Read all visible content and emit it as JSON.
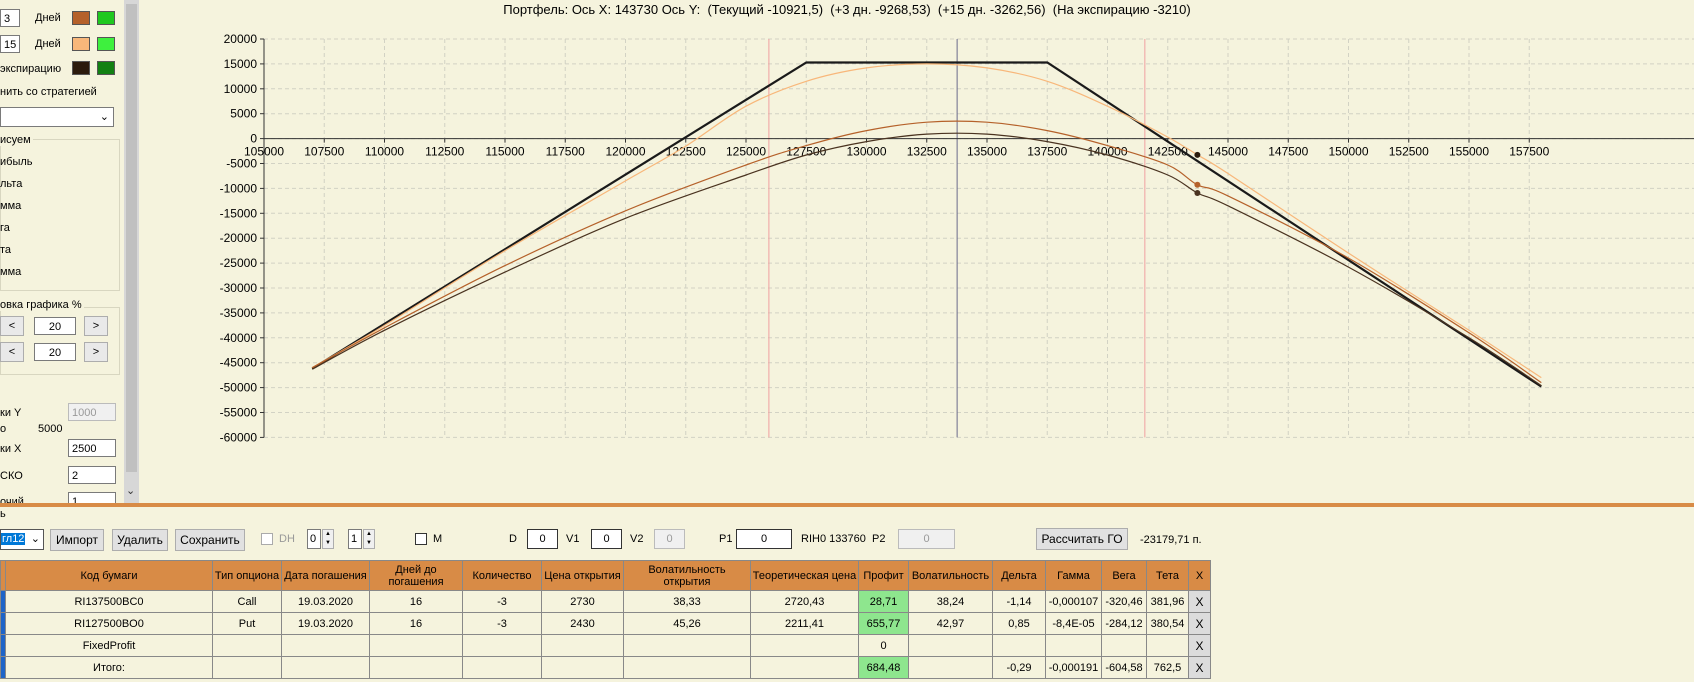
{
  "left_panel": {
    "day_rows": [
      {
        "value": "3",
        "label": "Дней",
        "color1": "#B5612A",
        "color2": "#1FC81F"
      },
      {
        "value": "15",
        "label": "Дней",
        "color1": "#F8B77A",
        "color2": "#3EF03E"
      }
    ],
    "expiry_label": "экспирацию",
    "expiry_colors": [
      "#2B1A0C",
      "#128012"
    ],
    "compare_label": "нить со стратегией",
    "draw_group_label": "исуем",
    "draw_items": [
      "ибыль",
      "льта",
      "мма",
      "га",
      "та",
      "мма"
    ],
    "chart_setting_label": "овка графика %",
    "scale1": "20",
    "scale2": "20",
    "prev_label": "<",
    "next_label": ">",
    "y_step_label": "ки Y",
    "y_step_value": "1000",
    "o_label": "о",
    "o_value": "5000",
    "x_step_label": "ки X",
    "x_step_value": "2500",
    "sko_label": "СКО",
    "sko_value": "2",
    "last_label": "очий",
    "last_value": "1"
  },
  "chart": {
    "title": "Портфель: Ось X: 143730 Ось Y:  (Текущий -10921,5)  (+3 дн. -9268,53)  (+15 дн. -3262,56)  (На экспирацию -3210)"
  },
  "chart_data": {
    "type": "line",
    "xlim": [
      105000,
      157500
    ],
    "ylim": [
      -60000,
      20000
    ],
    "x_ticks": [
      "105000",
      "107500",
      "110000",
      "112500",
      "115000",
      "117500",
      "120000",
      "122500",
      "125000",
      "127500",
      "130000",
      "132500",
      "135000",
      "137500",
      "140000",
      "142500",
      "145000",
      "147500",
      "150000",
      "152500",
      "155000",
      "157500"
    ],
    "y_ticks": [
      "20000",
      "15000",
      "10000",
      "5000",
      "0",
      "-5000",
      "-10000",
      "-15000",
      "-20000",
      "-25000",
      "-30000",
      "-35000",
      "-40000",
      "-45000",
      "-50000",
      "-55000",
      "-60000"
    ],
    "grid": true,
    "vertical_markers": {
      "current_price": 133760,
      "cursor_x": 143730,
      "sigma_lines": [
        125950,
        141550
      ]
    },
    "series": [
      {
        "color": "#1A1A1A",
        "width": 2.2,
        "x": [
          107000,
          127500,
          137500,
          158000
        ],
        "y": [
          -46200,
          15290,
          15290,
          -49800
        ]
      },
      {
        "color": "#F8B77A",
        "width": 1.2,
        "x": [
          107000,
          110000,
          115000,
          120000,
          122500,
          125000,
          127500,
          130000,
          132500,
          135000,
          137500,
          140000,
          142500,
          143730,
          145000,
          150000,
          155000,
          158000
        ],
        "y": [
          -46000,
          -37500,
          -22500,
          -8500,
          -1500,
          6500,
          11500,
          14200,
          15000,
          14200,
          11500,
          6500,
          300,
          -3262,
          -7000,
          -23000,
          -38500,
          -48000
        ]
      },
      {
        "color": "#B5612A",
        "width": 1.2,
        "x": [
          107000,
          110000,
          115000,
          120000,
          125000,
          127500,
          130000,
          132500,
          135000,
          137500,
          140000,
          142500,
          143730,
          145000,
          150000,
          155000,
          158000
        ],
        "y": [
          -46000,
          -38000,
          -25500,
          -14500,
          -5300,
          -1400,
          1600,
          3300,
          3300,
          1600,
          -1400,
          -5300,
          -9268,
          -11500,
          -24000,
          -39000,
          -49000
        ]
      },
      {
        "color": "#4A3320",
        "width": 1.2,
        "x": [
          107000,
          110000,
          115000,
          120000,
          125000,
          127500,
          130000,
          132500,
          135000,
          137500,
          140000,
          142500,
          143730,
          145000,
          150000,
          155000,
          158000
        ],
        "y": [
          -46300,
          -38500,
          -26800,
          -16000,
          -7300,
          -3300,
          -600,
          900,
          900,
          -600,
          -3300,
          -7300,
          -10921,
          -13500,
          -25800,
          -40000,
          -49600
        ]
      }
    ],
    "markers": [
      {
        "x": 143730,
        "y": -3262,
        "color": "#2B1A0C"
      },
      {
        "x": 143730,
        "y": -9268,
        "color": "#B5612A"
      },
      {
        "x": 143730,
        "y": -10921,
        "color": "#4A3320"
      }
    ]
  },
  "toolbar": {
    "header_fragment": "ь",
    "combo_value": "гл12",
    "import_label": "Импорт",
    "delete_label": "Удалить",
    "save_label": "Сохранить",
    "dh_label": "DH",
    "spin1": "0",
    "spin2": "1",
    "m_label": "M",
    "d_label": "D",
    "d_value": "0",
    "v1_label": "V1",
    "v1_value": "0",
    "v2_label": "V2",
    "v2_value": "0",
    "p1_label": "P1",
    "p1_value": "0",
    "ri_label": "RIH0 133760",
    "p2_label": "P2",
    "p2_value": "0",
    "calc_label": "Рассчитать ГО",
    "go_value": "-23179,71 п."
  },
  "table": {
    "headers": [
      "Код бумаги",
      "Тип опциона",
      "Дата погашения",
      "Дней до погашения",
      "Количество",
      "Цена открытия",
      "Волатильность открытия",
      "Теоретическая цена",
      "Профит",
      "Волатильность",
      "Дельта",
      "Гамма",
      "Вега",
      "Тета",
      "X"
    ],
    "rows": [
      {
        "code": "RI137500BC0",
        "type": "Call",
        "date": "19.03.2020",
        "days": "16",
        "qty": "-3",
        "price": "2730",
        "vol_open": "38,33",
        "theo": "2720,43",
        "profit": "28,71",
        "vol": "38,24",
        "delta": "-1,14",
        "gamma": "-0,000107",
        "vega": "-320,46",
        "theta": "381,96",
        "x": "X"
      },
      {
        "code": "RI127500BO0",
        "type": "Put",
        "date": "19.03.2020",
        "days": "16",
        "qty": "-3",
        "price": "2430",
        "vol_open": "45,26",
        "theo": "2211,41",
        "profit": "655,77",
        "vol": "42,97",
        "delta": "0,85",
        "gamma": "-8,4E-05",
        "vega": "-284,12",
        "theta": "380,54",
        "x": "X"
      },
      {
        "code": "FixedProfit",
        "type": "",
        "date": "",
        "days": "",
        "qty": "",
        "price": "",
        "vol_open": "",
        "theo": "",
        "profit": "0",
        "vol": "",
        "delta": "",
        "gamma": "",
        "vega": "",
        "theta": "",
        "x": "X"
      },
      {
        "code": "Итого:",
        "type": "",
        "date": "",
        "days": "",
        "qty": "",
        "price": "",
        "vol_open": "",
        "theo": "",
        "profit": "684,48",
        "vol": "",
        "delta": "-0,29",
        "gamma": "-0,000191",
        "vega": "-604,58",
        "theta": "762,5",
        "x": "X"
      }
    ]
  }
}
